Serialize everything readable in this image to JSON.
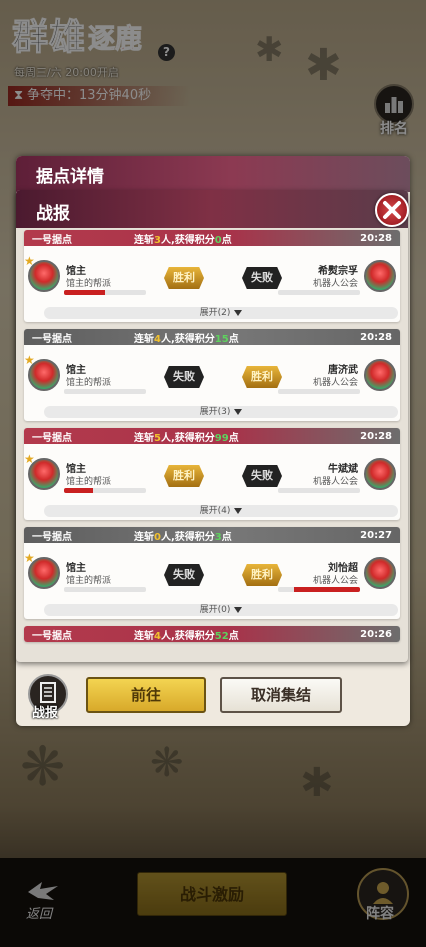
{
  "hud": {
    "logo_main": "群雄",
    "logo_accent": "逐鹿",
    "schedule": "每周三/六 20:00开启",
    "timer_label": "争夺中：13分钟40秒",
    "rank_label": "排名"
  },
  "bottom_bar": {
    "back_label": "返回",
    "battle_incentive_label": "战斗激励",
    "lineup_label": "阵容"
  },
  "detail_panel": {
    "title": "据点详情",
    "report_tab_label": "战报",
    "go_label": "前往",
    "cancel_rally_label": "取消集结"
  },
  "report_panel": {
    "title": "战报"
  },
  "reports": [
    {
      "point": "一号据点",
      "streak_prefix": "连斩",
      "kills": "3",
      "kills_suffix": "人,获得积分",
      "score": "0",
      "score_suffix": "点",
      "time": "20:28",
      "header_color": "red",
      "left_name": "馆主",
      "left_guild": "馆主的帮派",
      "left_result": "胜利",
      "left_hp": 0.5,
      "right_name": "希熨宗孚",
      "right_guild": "机器人公会",
      "right_result": "失败",
      "right_hp": 0,
      "expand_label": "展开(2)"
    },
    {
      "point": "一号据点",
      "streak_prefix": "连斩",
      "kills": "4",
      "kills_suffix": "人,获得积分",
      "score": "15",
      "score_suffix": "点",
      "time": "20:28",
      "header_color": "gray",
      "left_name": "馆主",
      "left_guild": "馆主的帮派",
      "left_result": "失败",
      "left_hp": 0,
      "right_name": "唐济武",
      "right_guild": "机器人公会",
      "right_result": "胜利",
      "right_hp": 0,
      "expand_label": "展开(3)"
    },
    {
      "point": "一号据点",
      "streak_prefix": "连斩",
      "kills": "5",
      "kills_suffix": "人,获得积分",
      "score": "99",
      "score_suffix": "点",
      "time": "20:28",
      "header_color": "red",
      "left_name": "馆主",
      "left_guild": "馆主的帮派",
      "left_result": "胜利",
      "left_hp": 0.35,
      "right_name": "牛斌斌",
      "right_guild": "机器人公会",
      "right_result": "失败",
      "right_hp": 0,
      "expand_label": "展开(4)"
    },
    {
      "point": "一号据点",
      "streak_prefix": "连斩",
      "kills": "0",
      "kills_suffix": "人,获得积分",
      "score": "3",
      "score_suffix": "点",
      "time": "20:27",
      "header_color": "gray",
      "left_name": "馆主",
      "left_guild": "馆主的帮派",
      "left_result": "失败",
      "left_hp": 0,
      "right_name": "刘怡超",
      "right_guild": "机器人公会",
      "right_result": "胜利",
      "right_hp": 0.8,
      "expand_label": "展开(0)"
    },
    {
      "point": "一号据点",
      "streak_prefix": "连斩",
      "kills": "4",
      "kills_suffix": "人,获得积分",
      "score": "52",
      "score_suffix": "点",
      "time": "20:26",
      "header_color": "red"
    }
  ],
  "colors": {
    "accent_red": "#b33a4c",
    "score_green": "#5ed15e",
    "kills_yellow": "#f1c12e",
    "hp_red": "#c92020",
    "gold_button": "#e4bd3c"
  }
}
